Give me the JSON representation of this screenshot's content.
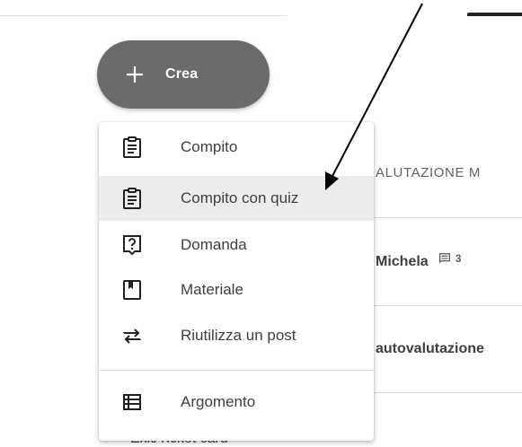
{
  "crea_button": {
    "label": "Crea",
    "icon": "plus-icon"
  },
  "menu": {
    "items": [
      {
        "label": "Compito",
        "icon": "assignment-icon"
      },
      {
        "label": "Compito con quiz",
        "icon": "quiz-assignment-icon"
      },
      {
        "label": "Domanda",
        "icon": "question-icon"
      },
      {
        "label": "Materiale",
        "icon": "material-icon"
      },
      {
        "label": "Riutilizza un post",
        "icon": "reuse-icon"
      },
      {
        "label": "Argomento",
        "icon": "topic-icon"
      }
    ]
  },
  "stream": {
    "topic_header": "ALUTAZIONE M",
    "post1_author": "Michela",
    "post1_comments": "3",
    "post2_title": "autovalutazione",
    "peek_text": "Exit/Ticket card"
  },
  "colors": {
    "button_bg": "#6b6b6b",
    "highlight_bg": "#ececec",
    "icon_color": "#202124",
    "text_color": "#3c4043"
  }
}
